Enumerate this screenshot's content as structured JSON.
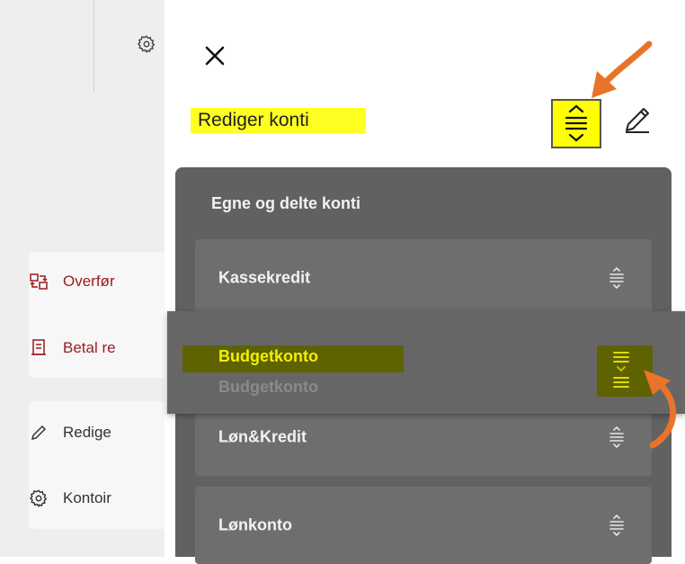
{
  "background": {
    "cards": [
      {
        "items": [
          {
            "icon": "transfer-icon",
            "label": "Overfør"
          },
          {
            "icon": "bill-icon",
            "label": "Betal re"
          }
        ]
      },
      {
        "items": [
          {
            "icon": "pencil-icon",
            "label": "Redige"
          },
          {
            "icon": "gear-icon",
            "label": "Kontoir"
          }
        ]
      }
    ]
  },
  "panel": {
    "title": "Rediger konti",
    "section_title": "Egne og delte konti",
    "accounts": [
      "Kassekredit",
      "Løn&Kredit",
      "Lønkonto"
    ],
    "dragging": {
      "label": "Budgetkonto",
      "ghost_label": "Budgetkonto"
    }
  },
  "colors": {
    "highlight": "#ffff00",
    "annotation_arrow": "#e8742a",
    "sheet": "#616161",
    "accent_red": "#9a1b1e"
  }
}
